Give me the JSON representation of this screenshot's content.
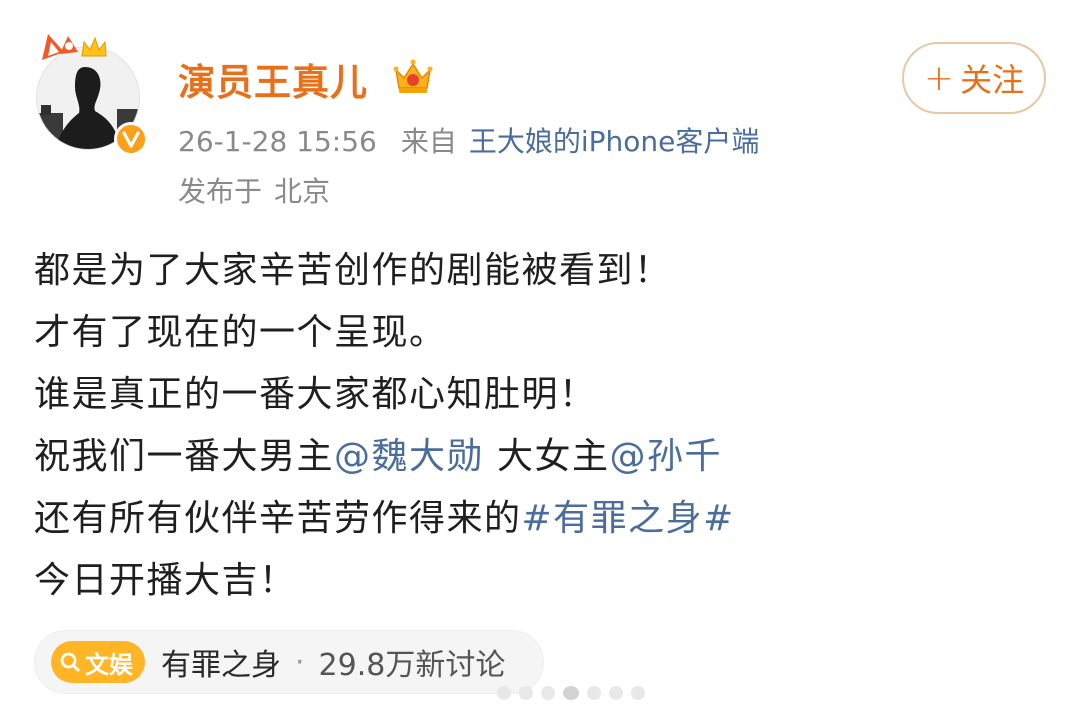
{
  "post": {
    "username": "演员王真儿",
    "time": "26-1-28 15:56",
    "source_prefix": "来自",
    "source_device": "王大娘的iPhone客户端",
    "location_prefix": "发布于",
    "location": "北京",
    "follow_label": "关注",
    "follow_plus": "+",
    "lines": [
      {
        "text": "都是为了大家辛苦创作的剧能被看到！"
      },
      {
        "text": "才有了现在的一个呈现。"
      },
      {
        "text": "谁是真正的一番大家都心知肚明！"
      },
      {
        "prefix": "祝我们一番大男主",
        "mention1": "@魏大勋",
        "middle": " 大女主",
        "mention2": "@孙千"
      },
      {
        "prefix": "还有所有伙伴辛苦劳作得来的",
        "hashtag": "#有罪之身#"
      },
      {
        "text": "今日开播大吉！"
      }
    ]
  },
  "topic": {
    "tag_label": "文娱",
    "name": "有罪之身",
    "separator": "·",
    "count": "29.8万新讨论"
  },
  "colors": {
    "username": "#e8701a",
    "link": "#4a6d9c",
    "meta": "#8a8a8a",
    "topic_tag": "#ffb526",
    "verified": "#ff9f1a"
  },
  "icons": {
    "crown": "crown-icon",
    "verified": "verified-icon",
    "search": "search-icon",
    "avatar_decoration": "fox-ears-crown-icon"
  },
  "pager": {
    "count": 7,
    "active_index": 3
  }
}
